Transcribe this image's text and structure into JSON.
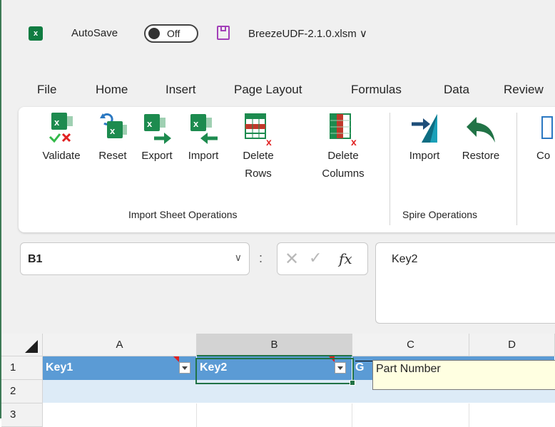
{
  "titlebar": {
    "app_icon": "excel-logo",
    "autosave_label": "AutoSave",
    "autosave_state": "Off",
    "filename": "BreezeUDF-2.1.0.xlsm",
    "filename_chevron": "∨"
  },
  "tabs": [
    "File",
    "Home",
    "Insert",
    "Page Layout",
    "Formulas",
    "Data",
    "Review"
  ],
  "ribbon": {
    "buttons": [
      {
        "label1": "Validate",
        "label2": ""
      },
      {
        "label1": "Reset",
        "label2": ""
      },
      {
        "label1": "Export",
        "label2": ""
      },
      {
        "label1": "Import",
        "label2": ""
      },
      {
        "label1": "Delete",
        "label2": "Rows"
      },
      {
        "label1": "Delete",
        "label2": "Columns"
      },
      {
        "label1": "Import",
        "label2": ""
      },
      {
        "label1": "Restore",
        "label2": ""
      },
      {
        "label1": "Co",
        "label2": ""
      }
    ],
    "groups": [
      "Import Sheet Operations",
      "Spire Operations"
    ]
  },
  "formula_bar": {
    "name_box": "B1",
    "name_chevron": "∨",
    "dots": ":",
    "cancel_icon": "✕",
    "enter_icon": "✓",
    "fx_label": "fx",
    "content": "Key2"
  },
  "grid": {
    "columns": [
      "A",
      "B",
      "C",
      "D"
    ],
    "rows": [
      "1",
      "2",
      "3"
    ],
    "cells": {
      "A1": "Key1",
      "B1": "Key2",
      "C1": "G"
    },
    "comment": "Part Number"
  },
  "colors": {
    "accent": "#217346",
    "header_fill": "#5b9bd5",
    "band_fill": "#ddebf7",
    "comment_bg": "#ffffe1"
  }
}
